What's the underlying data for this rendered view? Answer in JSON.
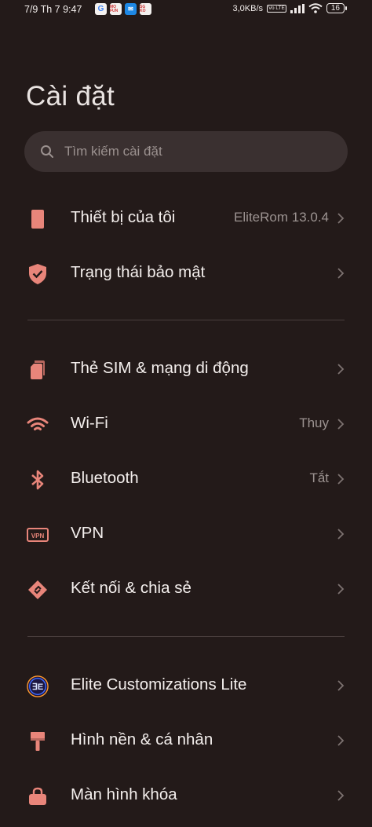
{
  "status_bar": {
    "time": "7/9 Th 7 9:47",
    "apps": [
      {
        "name": "google-app-icon",
        "text": "G"
      },
      {
        "name": "mo-fun-app-icon",
        "text": "MO FUN"
      },
      {
        "name": "messenger-app-icon",
        "text": "✉"
      },
      {
        "name": "sapo-app-icon",
        "text": "SG KO"
      }
    ],
    "network_speed": "3,0KB/s",
    "volte": "Vo LTE",
    "battery": "16"
  },
  "page": {
    "title": "Cài đặt"
  },
  "search": {
    "placeholder": "Tìm kiếm cài đặt"
  },
  "colors": {
    "background": "#231a19",
    "accent": "#e8857a",
    "search_bg": "#3a3030"
  },
  "groups": [
    {
      "items": [
        {
          "label": "Thiết bị của tôi",
          "value": "EliteRom 13.0.4",
          "icon": "phone-icon"
        },
        {
          "label": "Trạng thái bảo mật",
          "value": "",
          "icon": "shield-check-icon"
        }
      ]
    },
    {
      "items": [
        {
          "label": "Thẻ SIM & mạng di động",
          "value": "",
          "icon": "sim-card-icon"
        },
        {
          "label": "Wi-Fi",
          "value": "Thuy",
          "icon": "wifi-icon"
        },
        {
          "label": "Bluetooth",
          "value": "Tắt",
          "icon": "bluetooth-icon"
        },
        {
          "label": "VPN",
          "value": "",
          "icon": "vpn-icon"
        },
        {
          "label": "Kết nối & chia sẻ",
          "value": "",
          "icon": "connection-share-icon"
        }
      ]
    },
    {
      "items": [
        {
          "label": "Elite Customizations Lite",
          "value": "",
          "icon": "elite-logo-icon"
        },
        {
          "label": "Hình nền & cá nhân",
          "value": "",
          "icon": "wallpaper-brush-icon"
        },
        {
          "label": "Màn hình khóa",
          "value": "",
          "icon": "lock-screen-icon"
        }
      ]
    }
  ]
}
